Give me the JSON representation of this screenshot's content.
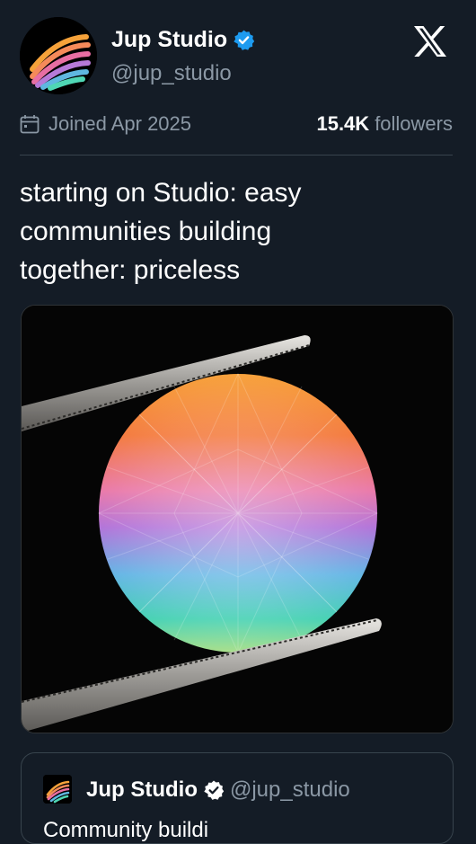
{
  "header": {
    "display_name": "Jup Studio",
    "handle": "@jup_studio",
    "verified": true
  },
  "profile_meta": {
    "joined": "Joined Apr 2025",
    "followers_count": "15.4K",
    "followers_label": "followers"
  },
  "tweet": {
    "text_line1": "starting on Studio: easy",
    "text_line2": "communities building",
    "text_line3": "together: priceless",
    "media_description_icon": "gem-held-by-tweezers-image"
  },
  "quote_tweet": {
    "display_name": "Jup Studio",
    "handle": "@jup_studio",
    "text_partial": "Community buildi"
  },
  "colors": {
    "background": "#141c26",
    "text_primary": "#ffffff",
    "text_secondary": "#8b98a5",
    "verified_blue": "#1d9bf0",
    "border": "#38444d"
  },
  "icons": {
    "x_logo": "x-logo-icon",
    "calendar": "calendar-icon",
    "verified": "verified-badge-icon"
  }
}
